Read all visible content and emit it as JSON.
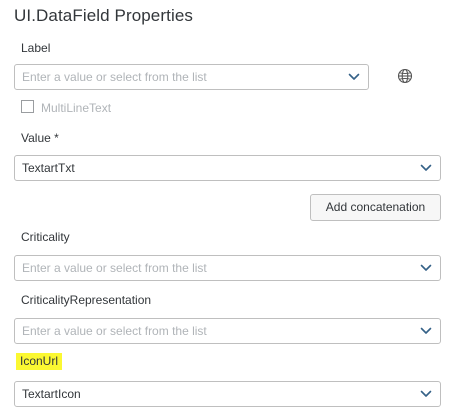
{
  "panel": {
    "title": "UI.DataField Properties"
  },
  "fields": {
    "label": {
      "caption": "Label",
      "placeholder": "Enter a value or select from the list",
      "value": ""
    },
    "multiline": {
      "caption": "MultiLineText",
      "checked": false
    },
    "value": {
      "caption": "Value *",
      "value": "TextartTxt"
    },
    "add_concatenation": {
      "label": "Add concatenation"
    },
    "criticality": {
      "caption": "Criticality",
      "placeholder": "Enter a value or select from the list",
      "value": ""
    },
    "criticality_representation": {
      "caption": "CriticalityRepresentation",
      "placeholder": "Enter a value or select from the list",
      "value": ""
    },
    "icon_url": {
      "caption": "IconUrl",
      "value": "TextartIcon",
      "highlight_color": "#fbf832"
    }
  },
  "icons": {
    "dropdown": "chevron-down-icon",
    "language": "globe-icon"
  },
  "colors": {
    "text": "#32363a",
    "placeholder": "#b0b4b8",
    "border": "#bfbfbf",
    "icon": "#346187",
    "highlight": "#fbf832"
  }
}
